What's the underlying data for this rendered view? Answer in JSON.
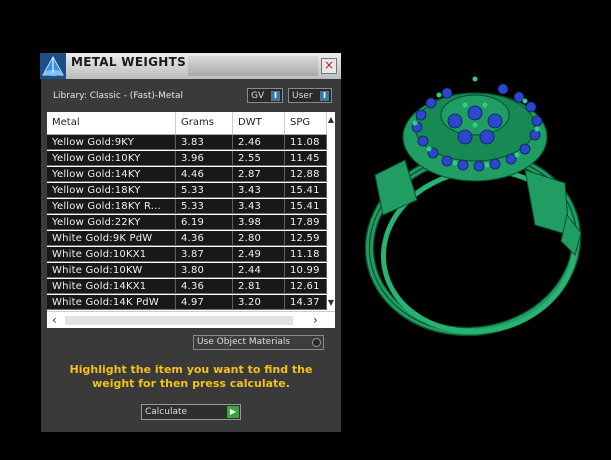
{
  "panel": {
    "title": "METAL WEIGHTS",
    "close_label": "×",
    "library": "Library: Classic - (Fast)-Metal",
    "toggles": [
      {
        "label": "GV",
        "indicator": "I"
      },
      {
        "label": "User",
        "indicator": "I"
      }
    ],
    "columns": [
      "Metal",
      "Grams",
      "DWT",
      "SPG"
    ],
    "rows": [
      [
        "Yellow Gold:9KY",
        "3.83",
        "2.46",
        "11.08"
      ],
      [
        "Yellow Gold:10KY",
        "3.96",
        "2.55",
        "11.45"
      ],
      [
        "Yellow Gold:14KY",
        "4.46",
        "2.87",
        "12.88"
      ],
      [
        "Yellow Gold:18KY",
        "5.33",
        "3.43",
        "15.41"
      ],
      [
        "Yellow Gold:18KY R...",
        "5.33",
        "3.43",
        "15.41"
      ],
      [
        "Yellow Gold:22KY",
        "6.19",
        "3.98",
        "17.89"
      ],
      [
        "White Gold:9K PdW",
        "4.36",
        "2.80",
        "12.59"
      ],
      [
        "White Gold:10KX1",
        "3.87",
        "2.49",
        "11.18"
      ],
      [
        "White Gold:10KW",
        "3.80",
        "2.44",
        "10.99"
      ],
      [
        "White Gold:14KX1",
        "4.36",
        "2.81",
        "12.61"
      ],
      [
        "White Gold:14K PdW",
        "4.97",
        "3.20",
        "14.37"
      ]
    ],
    "use_object_materials": "Use Object Materials",
    "instruction": "Highlight the item you want to find the weight for then press calculate.",
    "calculate_label": "Calculate"
  },
  "colors": {
    "accent_text": "#f2c21a",
    "ring_green": "#1f9d62",
    "gem_blue": "#2a48c8"
  }
}
